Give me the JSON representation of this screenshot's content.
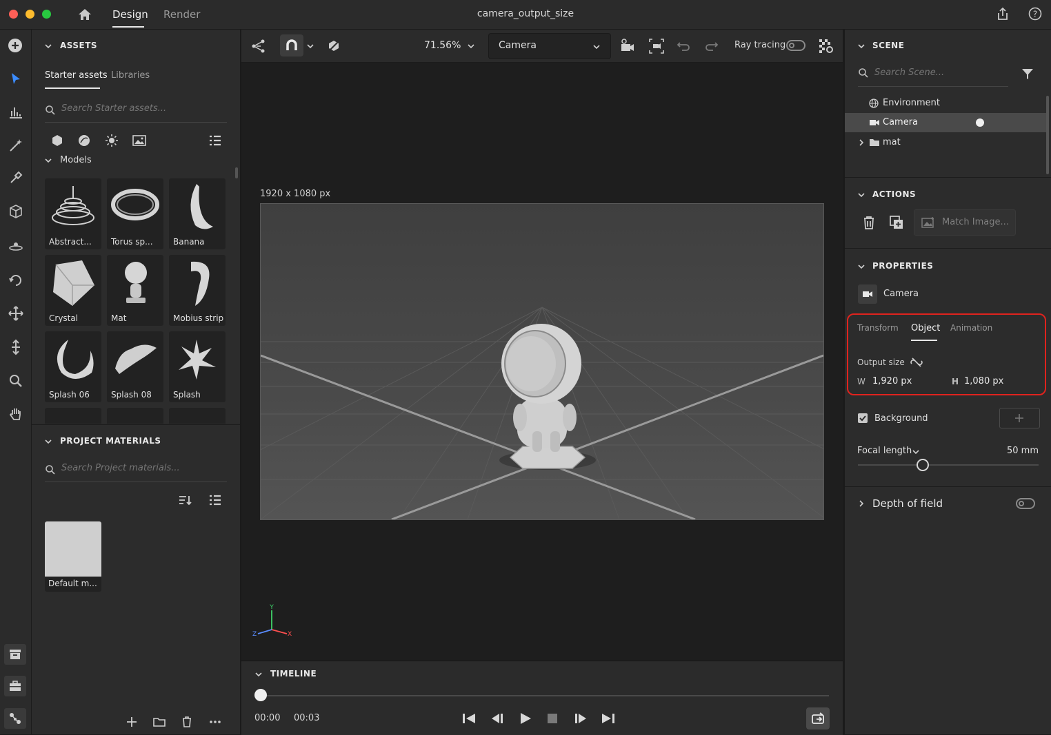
{
  "window": {
    "title": "camera_output_size",
    "tabs": [
      {
        "label": "Design"
      },
      {
        "label": "Render"
      }
    ]
  },
  "assets": {
    "section_title": "ASSETS",
    "tabs": [
      {
        "label": "Starter assets"
      },
      {
        "label": "Libraries"
      }
    ],
    "search_placeholder": "Search Starter assets...",
    "models_heading": "Models",
    "models": [
      {
        "label": "Abstract..."
      },
      {
        "label": "Torus sp..."
      },
      {
        "label": "Banana"
      },
      {
        "label": "Crystal"
      },
      {
        "label": "Mat"
      },
      {
        "label": "Mobius strip"
      },
      {
        "label": "Splash 06"
      },
      {
        "label": "Splash 08"
      },
      {
        "label": "Splash"
      }
    ]
  },
  "project_materials": {
    "section_title": "PROJECT MATERIALS",
    "search_placeholder": "Search Project materials...",
    "items": [
      {
        "label": "Default m..."
      }
    ]
  },
  "viewport_toolbar": {
    "zoom": "71.56%",
    "camera_select": "Camera",
    "ray_tracing_label": "Ray tracing"
  },
  "viewport": {
    "size_label": "1920 x 1080 px",
    "axes": {
      "x": "X",
      "y": "Y",
      "z": "Z"
    }
  },
  "timeline": {
    "section_title": "TIMELINE",
    "current_time": "00:00",
    "end_time": "00:03",
    "playhead_fraction": 0.0
  },
  "scene": {
    "section_title": "SCENE",
    "search_placeholder": "Search Scene...",
    "items": [
      {
        "label": "Environment"
      },
      {
        "label": "Camera"
      },
      {
        "label": "mat"
      }
    ]
  },
  "actions": {
    "section_title": "ACTIONS",
    "match_image_label": "Match Image..."
  },
  "properties": {
    "section_title": "PROPERTIES",
    "object_name": "Camera",
    "tabs": [
      {
        "label": "Transform"
      },
      {
        "label": "Object"
      },
      {
        "label": "Animation"
      }
    ],
    "output_size_label": "Output size",
    "width_label": "W",
    "width_value": "1,920 px",
    "height_label": "H",
    "height_value": "1,080 px",
    "background_label": "Background",
    "focal_length_label": "Focal length",
    "focal_length_value": "50 mm",
    "focal_slider_fraction": 0.36,
    "depth_of_field_label": "Depth of field"
  },
  "colors": {
    "accent_blue": "#3b8cff",
    "highlight_red": "#e0231e",
    "panel_bg": "#2c2c2c",
    "viewport_bg": "#1e1e1e"
  }
}
